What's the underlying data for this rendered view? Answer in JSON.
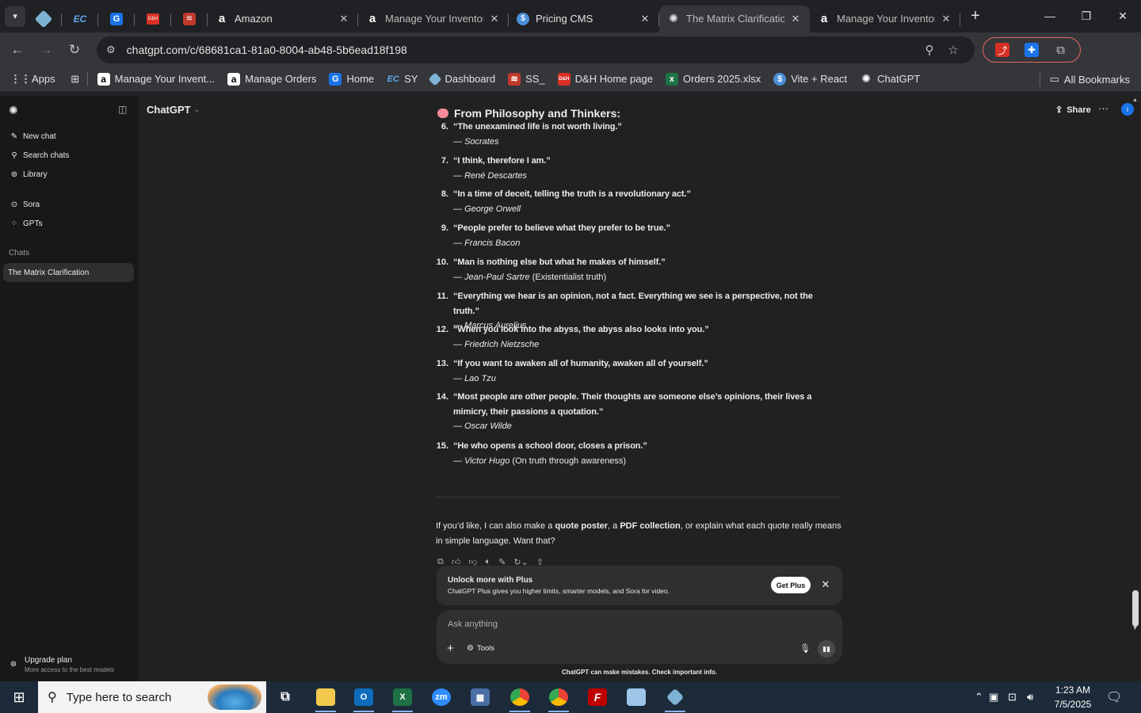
{
  "browser": {
    "tabs": [
      {
        "title": "Amazon",
        "icon": "amazon-icon"
      },
      {
        "title": "Manage Your Inventor",
        "icon": "amazon-icon"
      },
      {
        "title": "Pricing CMS",
        "icon": "dollar-icon"
      },
      {
        "title": "The Matrix Clarificatio",
        "icon": "chatgpt-icon",
        "active": true
      },
      {
        "title": "Manage Your Inventor",
        "icon": "amazon-icon"
      }
    ],
    "url": "chatgpt.com/c/68681ca1-81a0-8004-ab48-5b6ead18f198",
    "bookmarks": [
      {
        "label": "Apps",
        "icon": "apps-grid-icon"
      },
      {
        "label": "Manage Your Invent...",
        "icon": "amazon-icon"
      },
      {
        "label": "Manage Orders",
        "icon": "amazon-icon"
      },
      {
        "label": "Home",
        "icon": "home-icon"
      },
      {
        "label": "SY",
        "icon": "ec-icon"
      },
      {
        "label": "Dashboard",
        "icon": "dashboard-icon"
      },
      {
        "label": "SS_",
        "icon": "stack-icon"
      },
      {
        "label": "D&H Home page",
        "icon": "dh-icon"
      },
      {
        "label": "Orders 2025.xlsx",
        "icon": "excel-icon"
      },
      {
        "label": "Vite + React",
        "icon": "dollar-icon"
      },
      {
        "label": "ChatGPT",
        "icon": "chatgpt-icon"
      }
    ],
    "all_bookmarks": "All Bookmarks",
    "profile_initial": "i"
  },
  "sidebar": {
    "items": [
      {
        "label": "New chat",
        "icon": "compose-icon"
      },
      {
        "label": "Search chats",
        "icon": "search-icon"
      },
      {
        "label": "Library",
        "icon": "library-icon"
      },
      {
        "label": "Sora",
        "icon": "sora-icon"
      },
      {
        "label": "GPTs",
        "icon": "gpts-icon"
      }
    ],
    "chats_label": "Chats",
    "active_chat": "The Matrix Clarification",
    "upgrade_title": "Upgrade plan",
    "upgrade_sub": "More access to the best models"
  },
  "header": {
    "model": "ChatGPT",
    "share": "Share",
    "user_initial": "i"
  },
  "conversation": {
    "section_title": "From Philosophy and Thinkers:",
    "quotes": [
      {
        "num": "6.",
        "text": "“The unexamined life is not worth living.”",
        "author": "Socrates",
        "note": ""
      },
      {
        "num": "7.",
        "text": "“I think, therefore I am.”",
        "author": "René Descartes",
        "note": ""
      },
      {
        "num": "8.",
        "text": "“In a time of deceit, telling the truth is a revolutionary act.”",
        "author": "George Orwell",
        "note": ""
      },
      {
        "num": "9.",
        "text": "“People prefer to believe what they prefer to be true.”",
        "author": "Francis Bacon",
        "note": ""
      },
      {
        "num": "10.",
        "text": "“Man is nothing else but what he makes of himself.”",
        "author": "Jean-Paul Sartre",
        "note": "(Existentialist truth)"
      },
      {
        "num": "11.",
        "text": "“Everything we hear is an opinion, not a fact. Everything we see is a perspective, not the truth.”",
        "author": "Marcus Aurelius",
        "note": ""
      },
      {
        "num": "12.",
        "text": "“When you look into the abyss, the abyss also looks into you.”",
        "author": "Friedrich Nietzsche",
        "note": ""
      },
      {
        "num": "13.",
        "text": "“If you want to awaken all of humanity, awaken all of yourself.”",
        "author": "Lao Tzu",
        "note": ""
      },
      {
        "num": "14.",
        "text": "“Most people are other people. Their thoughts are someone else’s opinions, their lives a mimicry, their passions a quotation.”",
        "author": "Oscar Wilde",
        "note": ""
      },
      {
        "num": "15.",
        "text": "“He who opens a school door, closes a prison.”",
        "author": "Victor Hugo",
        "note": "(On truth through awareness)"
      }
    ],
    "followup_pre": "If you’d like, I can also make a ",
    "followup_b1": "quote poster",
    "followup_mid1": ", a ",
    "followup_b2": "PDF collection",
    "followup_post": ", or explain what each quote really means in simple language. Want that?"
  },
  "banner": {
    "title": "Unlock more with Plus",
    "subtitle": "ChatGPT Plus gives you higher limits, smarter models, and Sora for video.",
    "button": "Get Plus"
  },
  "composer": {
    "placeholder": "Ask anything",
    "tools": "Tools"
  },
  "disclaimer": "ChatGPT can make mistakes. Check important info.",
  "taskbar": {
    "search_placeholder": "Type here to search",
    "time": "1:23 AM",
    "date": "7/5/2025"
  }
}
